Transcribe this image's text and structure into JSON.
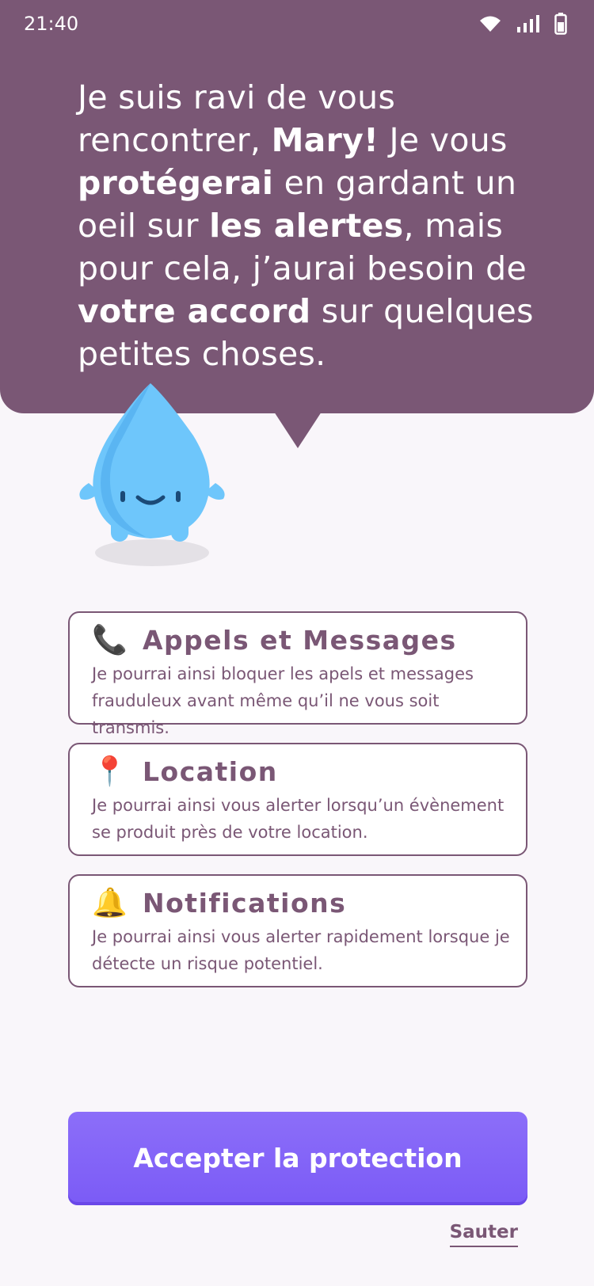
{
  "status_bar": {
    "time": "21:40"
  },
  "speech": {
    "parts": [
      {
        "text": "Je suis ravi de vous rencontrer, ",
        "bold": false
      },
      {
        "text": "Mary!",
        "bold": true
      },
      {
        "text": " Je vous ",
        "bold": false
      },
      {
        "text": "protégerai",
        "bold": true
      },
      {
        "text": " en gardant un oeil sur ",
        "bold": false
      },
      {
        "text": "les alertes",
        "bold": true
      },
      {
        "text": ", mais pour cela, j’aurai besoin de ",
        "bold": false
      },
      {
        "text": "votre accord",
        "bold": true
      },
      {
        "text": " sur quelques petites choses.",
        "bold": false
      }
    ]
  },
  "permissions": [
    {
      "icon": "phone-icon",
      "emoji": "📞",
      "title": "Appels et Messages",
      "description": "Je pourrai ainsi bloquer les apels et messages frauduleux avant même qu’il ne vous soit transmis."
    },
    {
      "icon": "pin-icon",
      "emoji": "📍",
      "title": "Location",
      "description": "Je pourrai ainsi vous alerter lorsqu’un évènement se produit près de votre location."
    },
    {
      "icon": "bell-icon",
      "emoji": "🔔",
      "title": "Notifications",
      "description": "Je pourrai ainsi vous alerter rapidement lorsque je détecte un risque potentiel."
    }
  ],
  "actions": {
    "accept_label": "Accepter la protection",
    "skip_label": "Sauter"
  },
  "colors": {
    "primary": "#7a5775",
    "accent": "#7b5bf6",
    "background": "#f9f6fa",
    "mascot": "#6ec6fb"
  }
}
